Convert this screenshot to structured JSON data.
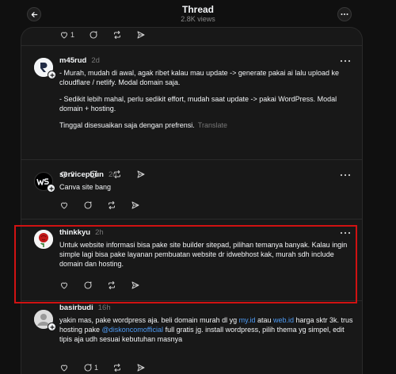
{
  "header": {
    "title": "Thread",
    "views": "2.8K views"
  },
  "top_actions": {
    "like_count": "1"
  },
  "posts": [
    {
      "username": "m45rud",
      "time": "2d",
      "paragraphs": [
        "- Murah, mudah di awal, agak ribet kalau mau update -> generate pakai ai lalu upload ke cloudflare / netlify. Modal domain saja.",
        "- Sedikit lebih mahal, perlu sedikit effort, mudah saat update -> pakai WordPress. Modal domain + hosting.",
        "Tinggal disesuaikan saja dengan prefrensi."
      ],
      "translate": "Translate",
      "like_count": "2"
    },
    {
      "username": "servicepbun",
      "time": "2d",
      "text": "Canva site bang"
    },
    {
      "username": "thinkkyu",
      "time": "2h",
      "text": "Untuk website informasi bisa pake site builder sitepad, pilihan temanya banyak. Kalau ingin simple lagi bisa pake layanan pembuatan website dr idwebhost kak, murah sdh include domain dan hosting."
    },
    {
      "username": "basirbudi",
      "time": "16h",
      "text_a": "yakin mas, pake wordpress aja. beli domain murah dl yg ",
      "link_a": "my.id",
      "text_b": " atau ",
      "link_b": "web.id",
      "text_c": " harga sktr 3k. trus hosting pake ",
      "link_c": "@diskoncomofficial",
      "text_d": " full gratis jg. install wordpress, pilih thema yg simpel, edit tipis aja udh sesuai kebutuhan masnya",
      "like_count": "1"
    }
  ],
  "colors": {
    "accent_link": "#4f9cf5",
    "highlight": "#d01212"
  }
}
